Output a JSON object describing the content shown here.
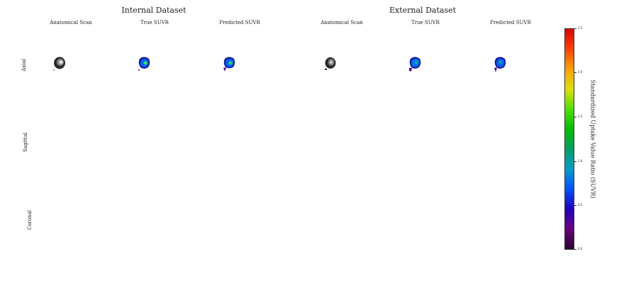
{
  "groups": [
    {
      "title": "Internal Dataset",
      "columns": [
        "Anatomical Scan",
        "True SUVR",
        "Predicted SUVR"
      ]
    },
    {
      "title": "External Dataset",
      "columns": [
        "Anatomical Scan",
        "True SUVR",
        "Predicted SUVR"
      ]
    }
  ],
  "rows": [
    "Axial",
    "Sagittal",
    "Coronal"
  ],
  "colorbar": {
    "label": "Standardized Uptake Value Ratio (SUVR)",
    "ticks": [
      "2.5",
      "2.0",
      "1.5",
      "1.0",
      "0.5",
      "0.0"
    ],
    "min": 0.0,
    "max": 2.5,
    "colors": [
      "#2a0033",
      "#6a0080",
      "#2000c0",
      "#0050ff",
      "#00a0d0",
      "#00a060",
      "#00c000",
      "#50e000",
      "#e0e000",
      "#ffa000",
      "#ff4000",
      "#e00000"
    ]
  }
}
